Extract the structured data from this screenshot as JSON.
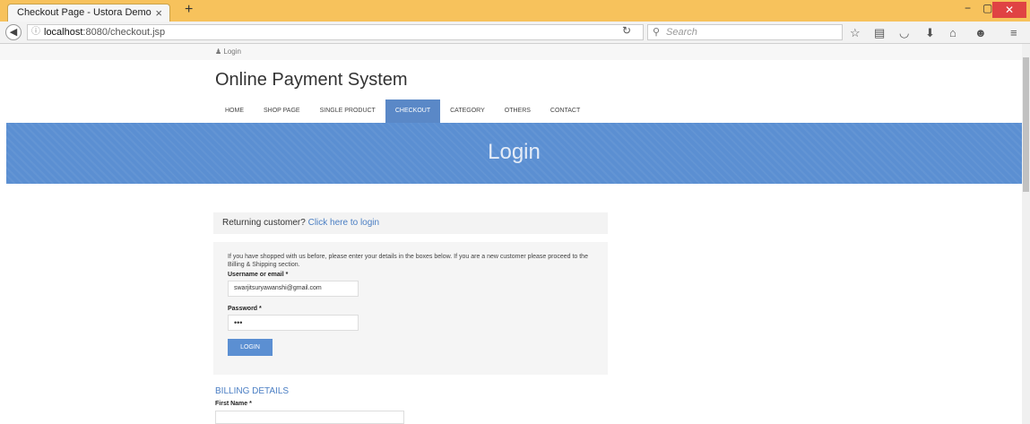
{
  "browser": {
    "tab_title": "Checkout Page - Ustora Demo",
    "tab_close": "×",
    "new_tab": "+",
    "url_host": "localhost",
    "url_rest": ":8080/checkout.jsp",
    "search_placeholder": "Search"
  },
  "page": {
    "top_login": "Login",
    "site_title": "Online Payment System",
    "menu": [
      "HOME",
      "SHOP PAGE",
      "SINGLE PRODUCT",
      "CHECKOUT",
      "CATEGORY",
      "OTHERS",
      "CONTACT"
    ],
    "active_menu": "CHECKOUT",
    "banner_title": "Login",
    "returning_text": "Returning customer?",
    "returning_link": "Click here to login",
    "intro_text": "If you have shopped with us before, please enter your details in the boxes below. If you are a new customer please proceed to the Billing & Shipping section.",
    "username_label": "Username or email *",
    "username_value": "swarjitsuryawanshi@gmail.com",
    "password_label": "Password *",
    "password_value": "•••",
    "login_button": "LOGIN",
    "billing_title": "BILLING DETAILS",
    "first_name_label": "First Name *"
  }
}
